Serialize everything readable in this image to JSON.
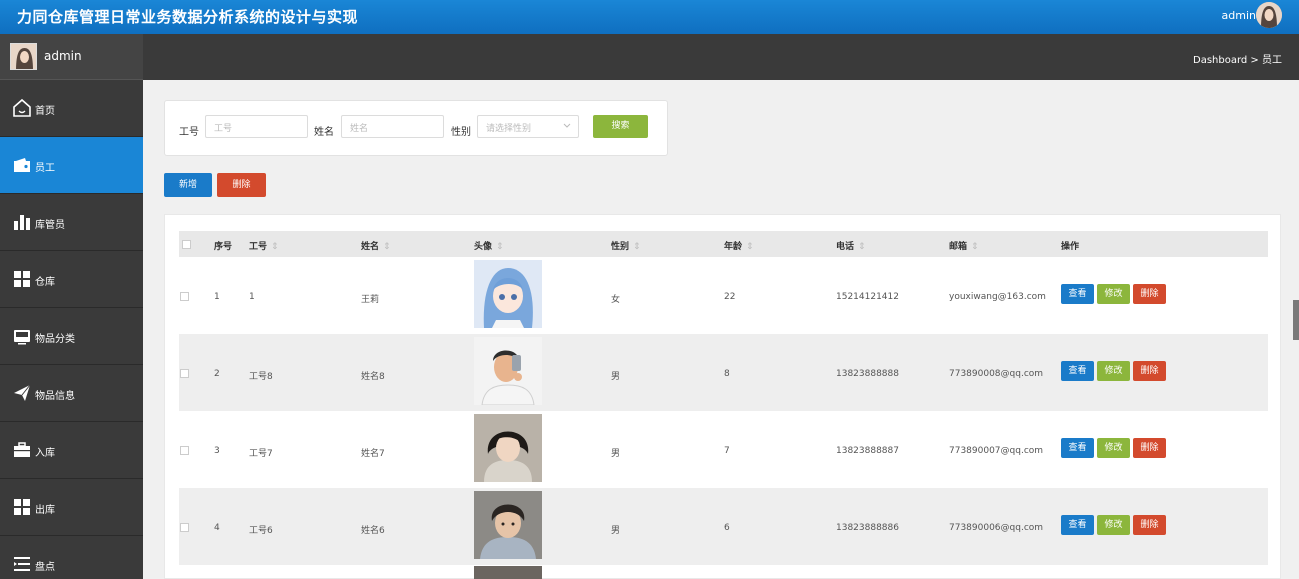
{
  "app": {
    "title": "力同仓库管理日常业务数据分析系统的设计与实现",
    "user": "admin"
  },
  "sidebar": {
    "user": "admin",
    "items": [
      {
        "label": "首页",
        "icon": "home-icon"
      },
      {
        "label": "员工",
        "icon": "wallet-icon"
      },
      {
        "label": "库管员",
        "icon": "bar-chart-icon"
      },
      {
        "label": "仓库",
        "icon": "grid-icon"
      },
      {
        "label": "物品分类",
        "icon": "inbox-icon"
      },
      {
        "label": "物品信息",
        "icon": "send-icon"
      },
      {
        "label": "入库",
        "icon": "briefcase-icon"
      },
      {
        "label": "出库",
        "icon": "grid-icon"
      },
      {
        "label": "盘点",
        "icon": "list-icon"
      }
    ]
  },
  "breadcrumb": "Dashboard > 员工",
  "search": {
    "job_label": "工号",
    "job_placeholder": "工号",
    "name_label": "姓名",
    "name_placeholder": "姓名",
    "gender_label": "性别",
    "gender_placeholder": "请选择性别",
    "search_button": "搜索"
  },
  "actions": {
    "add": "新增",
    "delete": "删除"
  },
  "table": {
    "headers": {
      "seq": "序号",
      "job": "工号",
      "name": "姓名",
      "photo": "头像",
      "gender": "性别",
      "age": "年龄",
      "phone": "电话",
      "email": "邮箱",
      "ops": "操作"
    },
    "op_labels": {
      "view": "查看",
      "edit": "修改",
      "delete": "删除"
    },
    "rows": [
      {
        "seq": "1",
        "job": "1",
        "name": "王莉",
        "gender": "女",
        "age": "22",
        "phone": "15214121412",
        "email": "youxiwang@163.com"
      },
      {
        "seq": "2",
        "job": "工号8",
        "name": "姓名8",
        "gender": "男",
        "age": "8",
        "phone": "13823888888",
        "email": "773890008@qq.com"
      },
      {
        "seq": "3",
        "job": "工号7",
        "name": "姓名7",
        "gender": "男",
        "age": "7",
        "phone": "13823888887",
        "email": "773890007@qq.com"
      },
      {
        "seq": "4",
        "job": "工号6",
        "name": "姓名6",
        "gender": "男",
        "age": "6",
        "phone": "13823888886",
        "email": "773890006@qq.com"
      }
    ]
  }
}
